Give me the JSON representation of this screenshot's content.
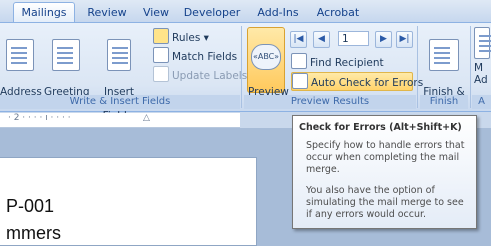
{
  "tabs": [
    "Mailings",
    "Review",
    "View",
    "Developer",
    "Add-Ins",
    "Acrobat"
  ],
  "groups": {
    "write_insert": {
      "label": "Write & Insert Fields",
      "address_block": "Address\nBlock",
      "greeting_line": "Greeting\nLine",
      "insert_merge_field": "Insert Merge\nField ▾",
      "rules": "Rules ▾",
      "match_fields": "Match Fields",
      "update_labels": "Update Labels"
    },
    "preview": {
      "label": "Preview Results",
      "preview_results": "Preview\nResults",
      "record": "1",
      "find_recipient": "Find Recipient",
      "auto_check": "Auto Check for Errors"
    },
    "finish": {
      "label": "Finish",
      "finish_merge": "Finish &\nMerge ▾"
    },
    "partial": {
      "top": "M",
      "bottom": "Ad",
      "label": "A"
    }
  },
  "ruler": "· 2 · · · · ı · · · ·",
  "tooltip": {
    "title": "Check for Errors (Alt+Shift+K)",
    "para1": "Specify how to handle errors that occur when completing the mail merge.",
    "para2": "You also have the option of simulating the mail merge to see if any errors would occur."
  },
  "document": {
    "line1": "P-001",
    "line2": "mmers"
  }
}
